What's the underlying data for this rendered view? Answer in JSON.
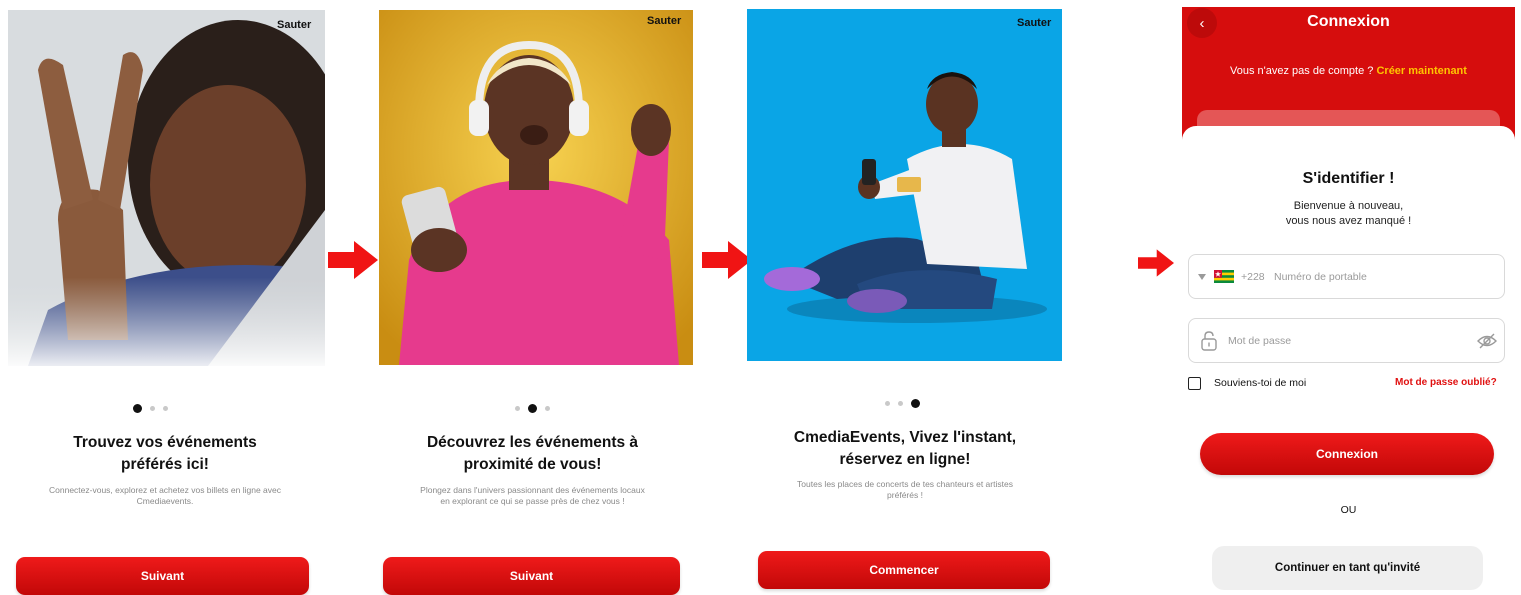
{
  "screens": [
    {
      "skip_label": "Sauter",
      "title": "Trouvez vos événements préférés ici!",
      "description": "Connectez-vous, explorez et achetez vos billets en ligne avec Cmediaevents.",
      "button_label": "Suivant",
      "active_dot": 1,
      "photo_background": "#d8dcdf"
    },
    {
      "skip_label": "Sauter",
      "title": "Découvrez les événements à proximité de vous!",
      "description": "Plongez dans l'univers passionnant des événements locaux en explorant ce qui se passe près de chez vous !",
      "button_label": "Suivant",
      "active_dot": 2,
      "photo_background": "#e9b224"
    },
    {
      "skip_label": "Sauter",
      "title": "CmediaEvents, Vivez l'instant, réservez en ligne!",
      "description": "Toutes les places de concerts de tes chanteurs et artistes préférés !",
      "button_label": "Commencer",
      "active_dot": 3,
      "photo_background": "#0aa5e6"
    }
  ],
  "login": {
    "header_title": "Connexion",
    "no_account_text": "Vous n'avez pas de compte ?",
    "create_link": "Créer maintenant",
    "title": "S'identifier !",
    "welcome_line1": "Bienvenue à nouveau,",
    "welcome_line2": "vous nous avez manqué !",
    "country_code": "+228",
    "phone_placeholder": "Numéro de portable",
    "password_placeholder": "Mot de passe",
    "remember_label": "Souviens-toi de moi",
    "forgot_link": "Mot de passe oublié?",
    "login_button": "Connexion",
    "separator": "OU",
    "guest_button": "Continuer en tant qu'invité"
  },
  "colors": {
    "accent_red": "#e01010",
    "header_red": "#d60d0d",
    "link_yellow": "#ffc400",
    "arrow_red": "#f01414"
  },
  "icons": [
    "back-chevron-icon",
    "dropdown-caret-icon",
    "togo-flag-icon",
    "lock-icon",
    "eye-off-icon",
    "flow-arrow-icon"
  ]
}
